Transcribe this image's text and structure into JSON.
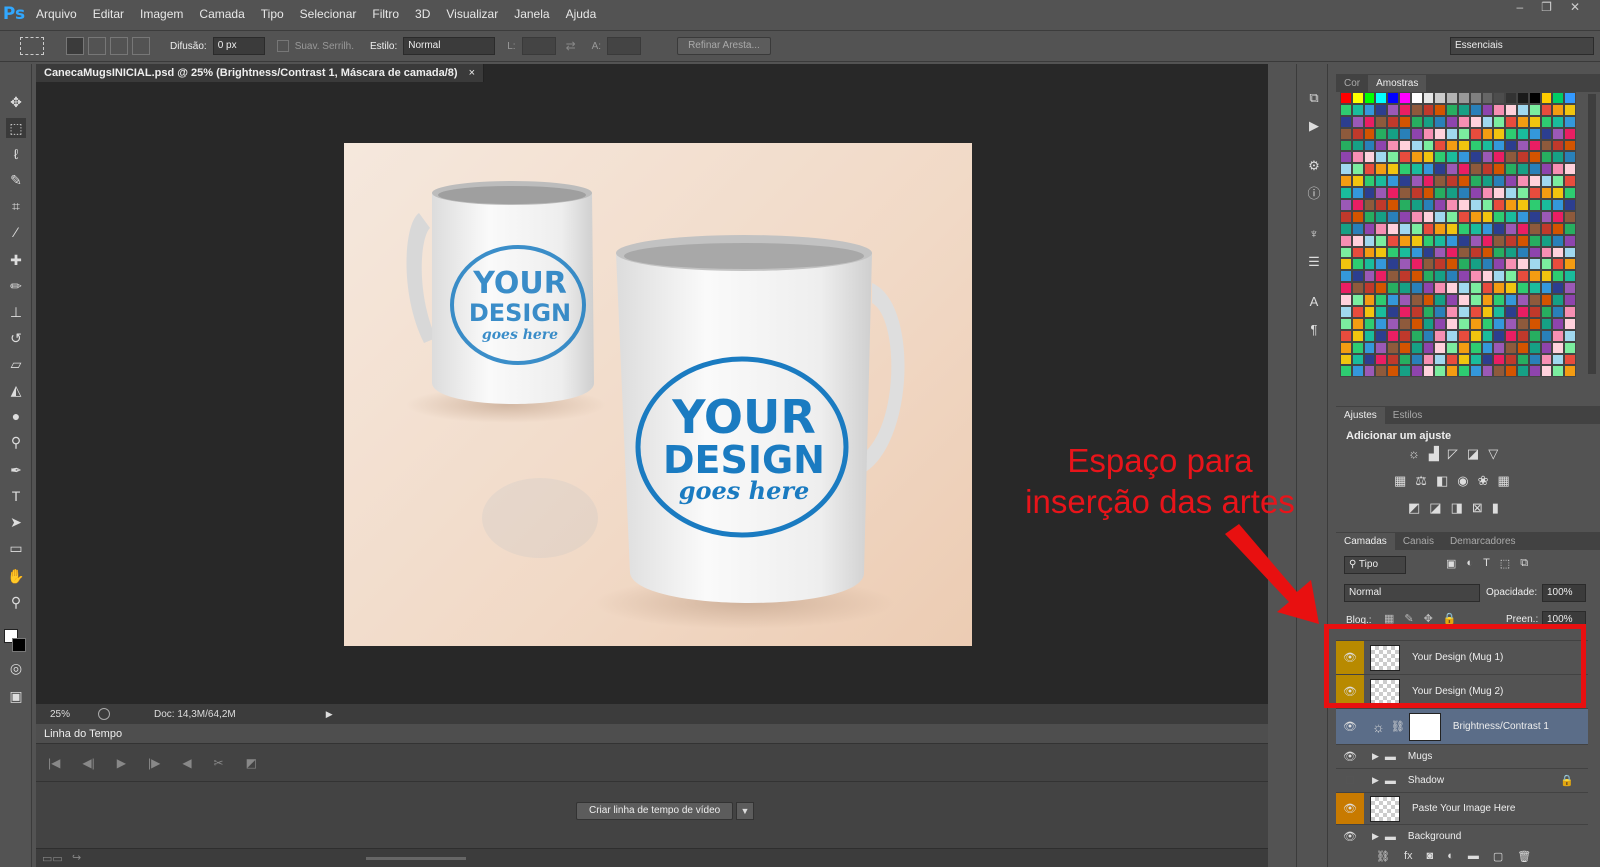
{
  "app": {
    "logo": "Ps"
  },
  "menu": [
    "Arquivo",
    "Editar",
    "Imagem",
    "Camada",
    "Tipo",
    "Selecionar",
    "Filtro",
    "3D",
    "Visualizar",
    "Janela",
    "Ajuda"
  ],
  "window_controls": [
    "–",
    "❐",
    "✕"
  ],
  "options": {
    "feather_label": "Difusão:",
    "feather_value": "0 px",
    "antialias_label": "Suav. Serrilh.",
    "style_label": "Estilo:",
    "style_value": "Normal",
    "w_label": "L:",
    "h_label": "A:",
    "refine_button": "Refinar Aresta...",
    "workspace": "Essenciais"
  },
  "document": {
    "tab_title": "CanecaMugsINICIAL.psd @ 25% (Brightness/Contrast 1, Máscara de camada/8)",
    "zoom": "25%",
    "doc_info": "Doc: 14,3M/64,2M"
  },
  "mug_print": {
    "line1": "YOUR",
    "line2": "DESIGN",
    "line3": "goes here"
  },
  "timeline": {
    "title": "Linha do Tempo",
    "create_button": "Criar linha de tempo de vídeo"
  },
  "swatches_panel": {
    "tabs": [
      "Cor",
      "Amostras"
    ],
    "active_tab": "Amostras"
  },
  "adjustments_panel": {
    "tabs": [
      "Ajustes",
      "Estilos"
    ],
    "heading": "Adicionar um ajuste"
  },
  "layers_panel": {
    "tabs": [
      "Camadas",
      "Canais",
      "Demarcadores"
    ],
    "filter_kind": "Tipo",
    "blend_mode": "Normal",
    "opacity_label": "Opacidade:",
    "opacity_value": "100%",
    "lock_label": "Bloq.:",
    "fill_label": "Preen.:",
    "fill_value": "100%",
    "layers": [
      {
        "name": "Your Design (Mug 1)",
        "kind": "smart"
      },
      {
        "name": "Your Design (Mug 2)",
        "kind": "smart"
      },
      {
        "name": "Brightness/Contrast 1",
        "kind": "adjustment"
      },
      {
        "name": "Mugs",
        "kind": "group"
      },
      {
        "name": "Shadow",
        "kind": "group"
      },
      {
        "name": "Paste Your Image Here",
        "kind": "pixel"
      },
      {
        "name": "Background",
        "kind": "group"
      }
    ]
  },
  "annotation": {
    "line1": "Espaço para",
    "line2": "inserção das artes",
    "color": "#e8141a"
  },
  "colors": {
    "accent_blue": "#1a7bc1",
    "highlight": "#b88a00"
  }
}
